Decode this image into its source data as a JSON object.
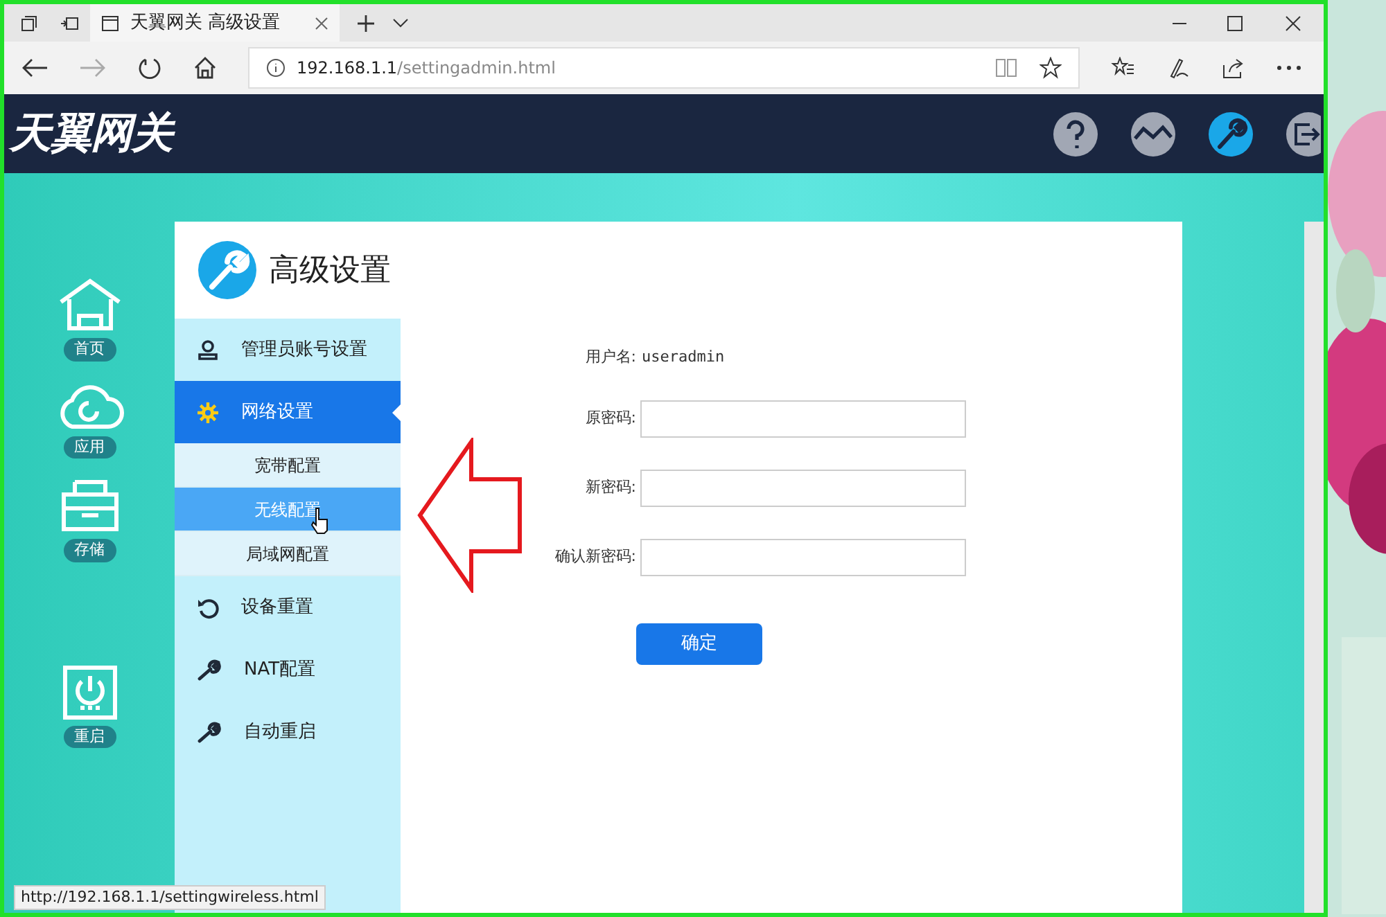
{
  "browser": {
    "tab_title": "天翼网关 高级设置",
    "url_host": "192.168.1.1",
    "url_path": "/settingadmin.html",
    "status_url": "http://192.168.1.1/settingwireless.html"
  },
  "header": {
    "logo": "天翼网关"
  },
  "nav": [
    {
      "label": "首页",
      "kind": "home"
    },
    {
      "label": "应用",
      "kind": "cloud"
    },
    {
      "label": "存储",
      "kind": "storage"
    },
    {
      "label": "重启",
      "kind": "power"
    }
  ],
  "card": {
    "title": "高级设置"
  },
  "menu": [
    {
      "label": "管理员账号设置",
      "kind": "user",
      "selected": false
    },
    {
      "label": "网络设置",
      "kind": "gear",
      "selected": true,
      "children": [
        {
          "label": "宽带配置",
          "selected": false
        },
        {
          "label": "无线配置",
          "selected": true
        },
        {
          "label": "局域网配置",
          "selected": false
        }
      ]
    },
    {
      "label": "设备重置",
      "kind": "reset",
      "selected": false
    },
    {
      "label": "NAT配置",
      "kind": "wrench",
      "selected": false
    },
    {
      "label": "自动重启",
      "kind": "wrench",
      "selected": false
    }
  ],
  "form": {
    "username_label": "用户名:",
    "username_value": "useradmin",
    "fields": [
      {
        "label": "原密码:"
      },
      {
        "label": "新密码:"
      },
      {
        "label": "确认新密码:"
      }
    ],
    "submit": "确定"
  }
}
